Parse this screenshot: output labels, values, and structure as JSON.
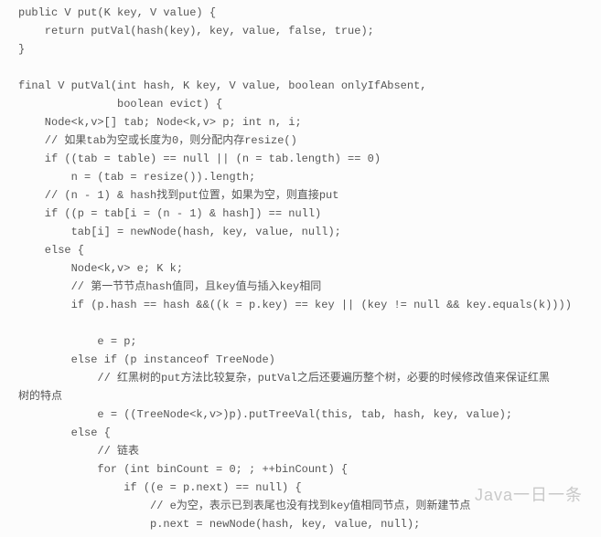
{
  "code_lines": [
    "public V put(K key, V value) {",
    "    return putVal(hash(key), key, value, false, true);",
    "}",
    "",
    "final V putVal(int hash, K key, V value, boolean onlyIfAbsent,",
    "               boolean evict) {",
    "    Node<k,v>[] tab; Node<k,v> p; int n, i;",
    "    // 如果tab为空或长度为0，则分配内存resize()",
    "    if ((tab = table) == null || (n = tab.length) == 0)",
    "        n = (tab = resize()).length;",
    "    // (n - 1) & hash找到put位置，如果为空，则直接put",
    "    if ((p = tab[i = (n - 1) & hash]) == null)",
    "        tab[i] = newNode(hash, key, value, null);",
    "    else {",
    "        Node<k,v> e; K k;",
    "        // 第一节节点hash值同，且key值与插入key相同",
    "        if (p.hash == hash &&((k = p.key) == key || (key != null && key.equals(k))))",
    "",
    "            e = p;",
    "        else if (p instanceof TreeNode)",
    "            // 红黑树的put方法比较复杂，putVal之后还要遍历整个树，必要的时候修改值来保证红黑",
    "树的特点",
    "            e = ((TreeNode<k,v>)p).putTreeVal(this, tab, hash, key, value);",
    "        else {",
    "            // 链表",
    "            for (int binCount = 0; ; ++binCount) {",
    "                if ((e = p.next) == null) {",
    "                    // e为空，表示已到表尾也没有找到key值相同节点，则新建节点",
    "                    p.next = newNode(hash, key, value, null);"
  ],
  "watermark": "Java一日一条"
}
